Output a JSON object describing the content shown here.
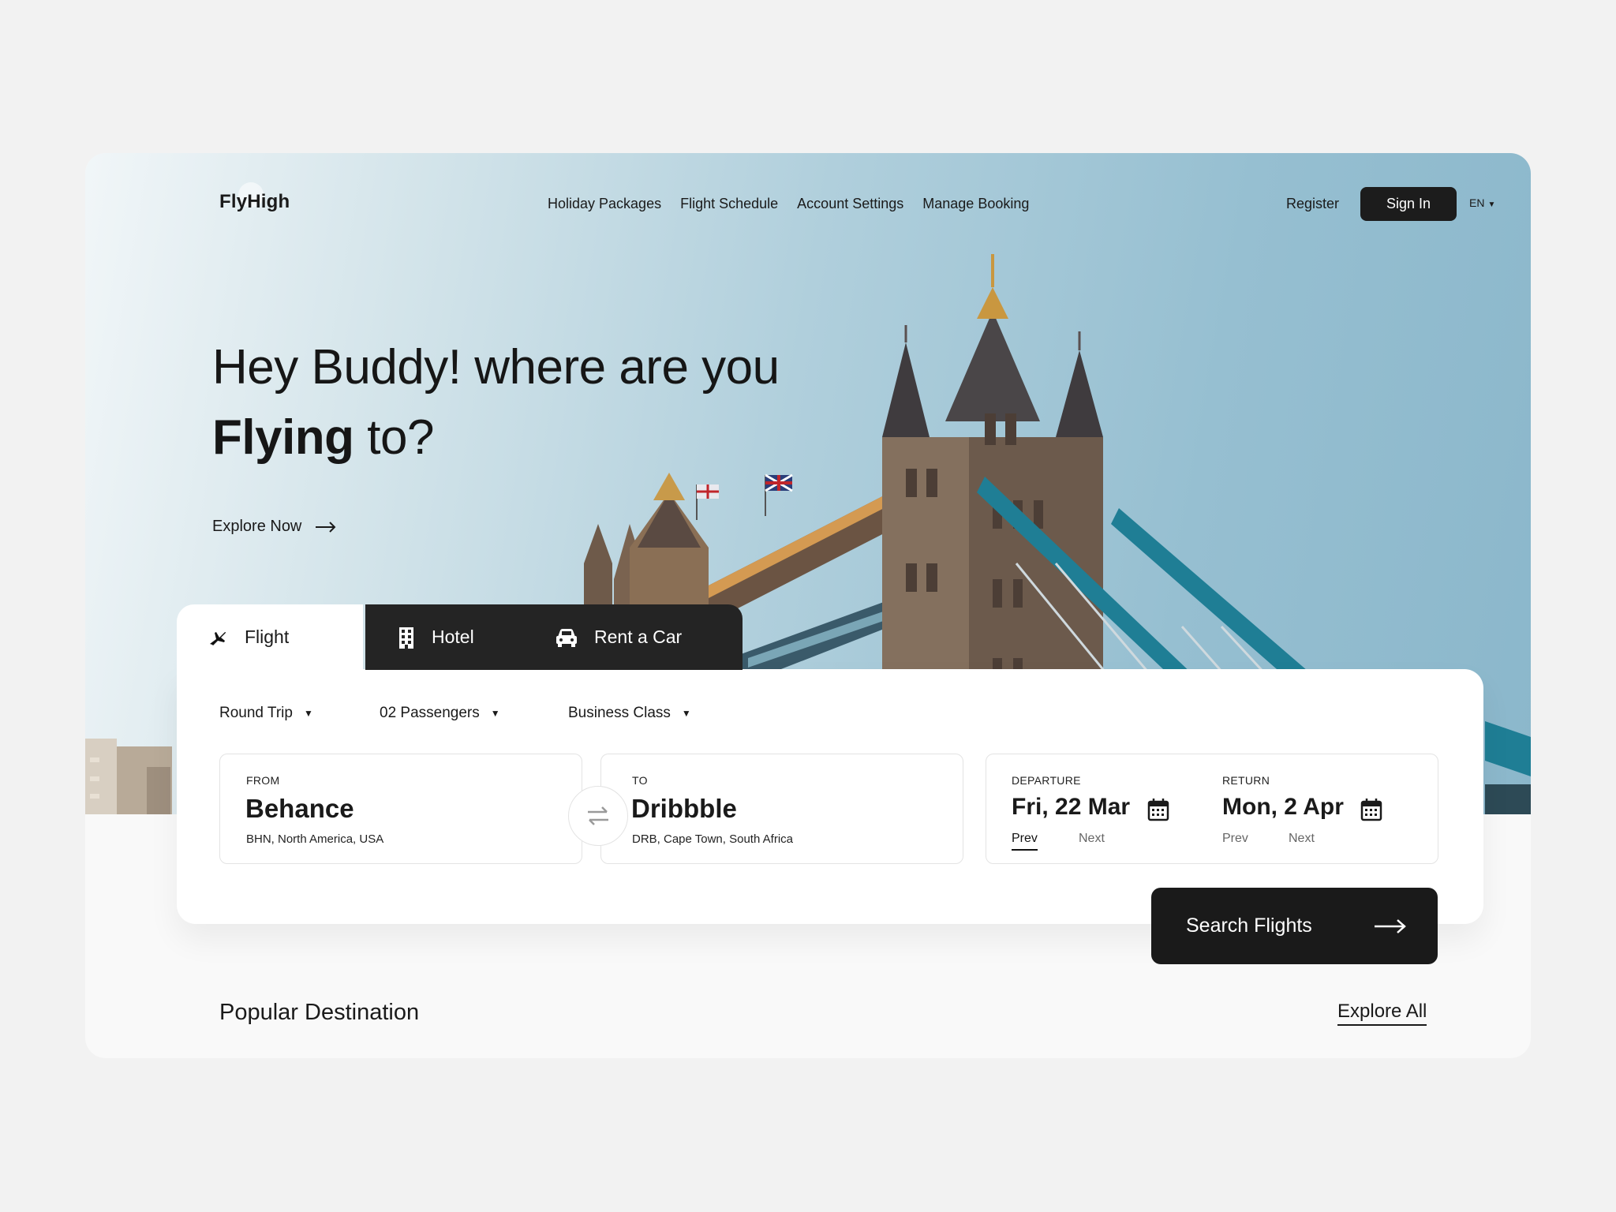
{
  "brand": {
    "logo": "FlyHigh"
  },
  "nav": {
    "links": [
      "Holiday Packages",
      "Flight Schedule",
      "Account Settings",
      "Manage Booking"
    ],
    "register": "Register",
    "sign_in": "Sign In",
    "language": "EN"
  },
  "hero": {
    "line1": "Hey Buddy! where are you",
    "line2_bold": "Flying",
    "line2_rest": " to?",
    "cta": "Explore Now"
  },
  "tabs": {
    "flight": "Flight",
    "hotel": "Hotel",
    "car": "Rent a Car"
  },
  "options": {
    "trip": "Round Trip",
    "passengers": "02 Passengers",
    "cabin": "Business Class"
  },
  "from": {
    "label": "FROM",
    "city": "Behance",
    "detail": "BHN, North America, USA"
  },
  "to": {
    "label": "TO",
    "city": "Dribbble",
    "detail": "DRB, Cape Town, South Africa"
  },
  "departure": {
    "label": "DEPARTURE",
    "date": "Fri, 22 Mar",
    "prev": "Prev",
    "next": "Next"
  },
  "return": {
    "label": "RETURN",
    "date": "Mon, 2 Apr",
    "prev": "Prev",
    "next": "Next"
  },
  "search_button": "Search Flights",
  "popular": {
    "title": "Popular Destination",
    "link": "Explore All"
  },
  "colors": {
    "accent": "#1a1a1a",
    "bridge": "#1f7e95",
    "sky": "#96bfd1"
  }
}
